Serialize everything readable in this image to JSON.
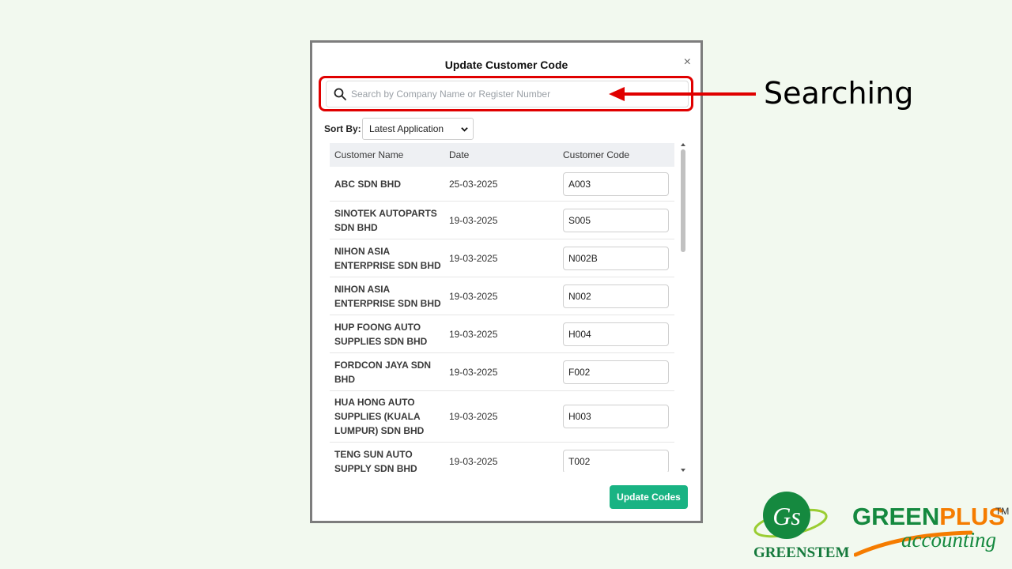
{
  "modal": {
    "title": "Update Customer Code",
    "close": "×",
    "search": {
      "placeholder": "Search by Company Name or Register Number",
      "value": ""
    },
    "sort": {
      "label": "Sort By:",
      "selected": "Latest Application"
    },
    "table": {
      "headers": [
        "Customer Name",
        "Date",
        "Customer Code"
      ],
      "rows": [
        {
          "name": "ABC SDN BHD",
          "date": "25-03-2025",
          "code": "A003"
        },
        {
          "name": "SINOTEK AUTOPARTS SDN BHD",
          "date": "19-03-2025",
          "code": "S005"
        },
        {
          "name": "NIHON ASIA ENTERPRISE SDN BHD",
          "date": "19-03-2025",
          "code": "N002B"
        },
        {
          "name": "NIHON ASIA ENTERPRISE SDN BHD",
          "date": "19-03-2025",
          "code": "N002"
        },
        {
          "name": "HUP FOONG AUTO SUPPLIES SDN BHD",
          "date": "19-03-2025",
          "code": "H004"
        },
        {
          "name": "FORDCON JAYA SDN BHD",
          "date": "19-03-2025",
          "code": "F002"
        },
        {
          "name": "HUA HONG AUTO SUPPLIES (KUALA LUMPUR) SDN BHD",
          "date": "19-03-2025",
          "code": "H003"
        },
        {
          "name": "TENG SUN AUTO SUPPLY SDN BHD",
          "date": "19-03-2025",
          "code": "T002"
        }
      ]
    },
    "update_button": "Update Codes"
  },
  "annotation": {
    "text": "Searching",
    "color": "#e00000"
  },
  "branding": {
    "greenstem": "GREENSTEM",
    "greenplus_a": "GREEN",
    "greenplus_b": "PLUS",
    "tm": "TM",
    "accounting": "accounting"
  },
  "colors": {
    "accent": "#19b383",
    "background": "#f2f9ef",
    "brand_green": "#15893f",
    "brand_orange": "#f57c00"
  },
  "icons": [
    "search-icon",
    "close-icon",
    "chevron-down-icon",
    "arrow-left-icon"
  ]
}
